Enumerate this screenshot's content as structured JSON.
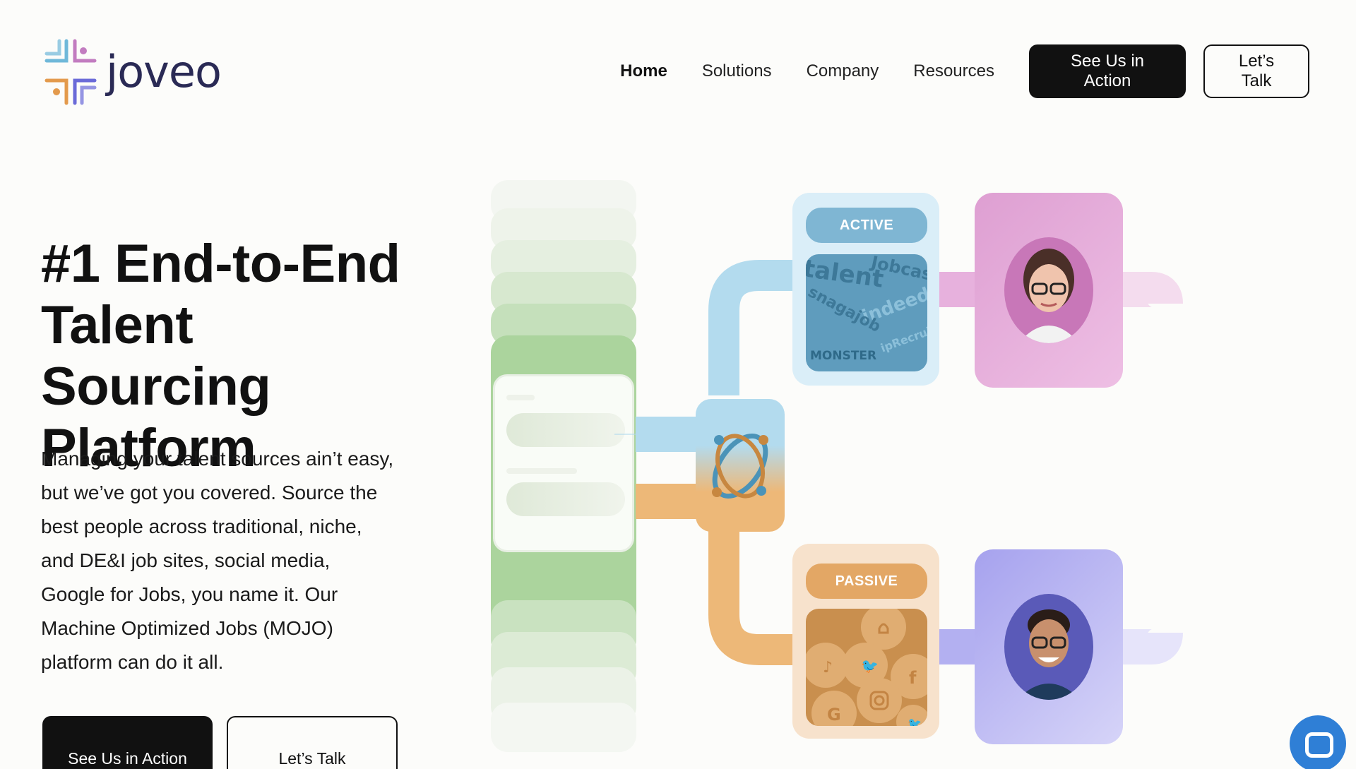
{
  "brand": {
    "name": "joveo",
    "colors": {
      "dark": "#111111",
      "navy": "#2a2a55",
      "chat": "#2f7fd6"
    }
  },
  "nav": {
    "items": [
      {
        "label": "Home",
        "active": true
      },
      {
        "label": "Solutions",
        "active": false
      },
      {
        "label": "Company",
        "active": false
      },
      {
        "label": "Resources",
        "active": false
      }
    ],
    "cta_primary": "See Us in Action",
    "cta_secondary": "Let’s Talk"
  },
  "hero": {
    "title_line1": "#1 End-to-End",
    "title_line2": "Talent Sourcing",
    "title_line3": "Platform",
    "description": "Managing your talent sources ain’t easy, but we’ve got you covered. Source the best people across traditional, niche, and DE&I job sites, social media, Google for Jobs, you name it. Our Machine Optimized Jobs (MOJO) platform can do it all.",
    "cta_primary": "See Us in Action",
    "cta_secondary": "Let’s Talk"
  },
  "illustration": {
    "active_label": "ACTIVE",
    "passive_label": "PASSIVE",
    "job_sites": [
      "talent",
      "Jobcas",
      "indeed",
      "snagajob",
      "ipRecruit",
      "MONSTER"
    ],
    "social_icons": [
      "snapchat-icon",
      "tiktok-icon",
      "twitter-icon",
      "facebook-icon",
      "google-icon",
      "instagram-icon",
      "twitter-icon"
    ],
    "colors": {
      "active": "#8fc3de",
      "passive": "#e9b57a",
      "pink_persona": "#e3a9d6",
      "purple_persona": "#aaa6ef",
      "green_stack": "#a9d39c"
    }
  },
  "chat": {
    "icon": "chat-icon"
  }
}
